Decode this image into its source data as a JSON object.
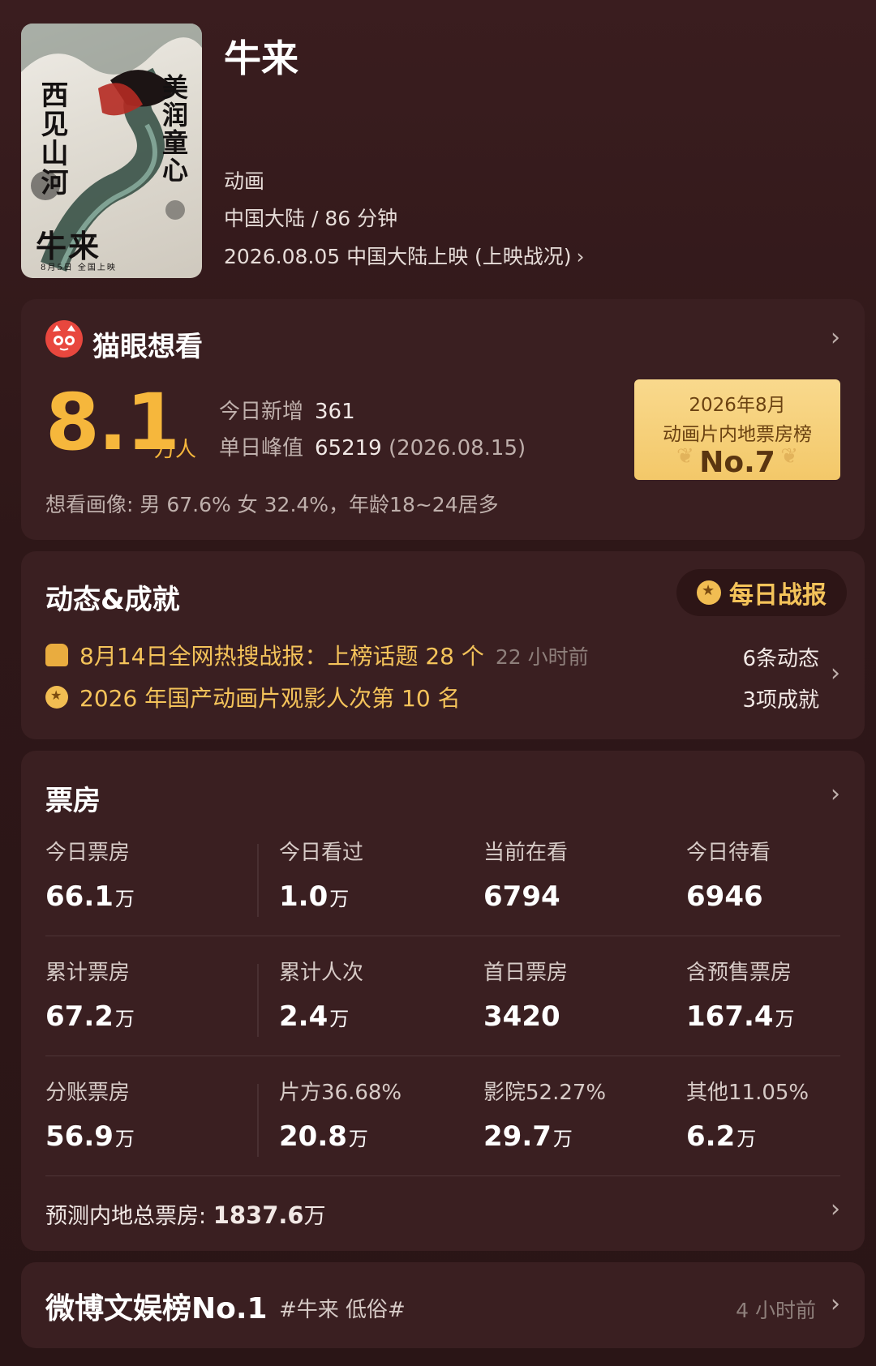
{
  "movie": {
    "poster_texts": [
      "西见山河",
      "美润童心",
      "牛来",
      "8月5日 全国上映"
    ],
    "title": "牛来",
    "genre": "动画",
    "region_runtime": "中国大陆 / 86 分钟",
    "release": "2026.08.05 中国大陆上映 (上映战况)"
  },
  "want": {
    "title": "猫眼想看",
    "number": "8.1",
    "unit": "万人",
    "today_label": "今日新增",
    "today_value": "361",
    "peak_label": "单日峰值",
    "peak_value": "65219",
    "peak_date": "(2026.08.15)",
    "portrait": "想看画像: 男 67.6%  女 32.4%，年龄18~24居多",
    "rank_line1": "2026年8月",
    "rank_line2": "动画片内地票房榜",
    "rank_line3": "No.7"
  },
  "dynamics": {
    "title": "动态&成就",
    "daily_button": "每日战报",
    "item1": "8月14日全网热搜战报：上榜话题 28 个",
    "item1_time": "22 小时前",
    "item2": "2026 年国产动画片观影人次第 10 名",
    "count1": "6条动态",
    "count2": "3项成就"
  },
  "boxoffice": {
    "title": "票房",
    "rows": [
      [
        {
          "label": "今日票房",
          "value": "66.1",
          "unit": "万"
        },
        {
          "label": "今日看过",
          "value": "1.0",
          "unit": "万"
        },
        {
          "label": "当前在看",
          "value": "6794",
          "unit": ""
        },
        {
          "label": "今日待看",
          "value": "6946",
          "unit": ""
        }
      ],
      [
        {
          "label": "累计票房",
          "value": "67.2",
          "unit": "万"
        },
        {
          "label": "累计人次",
          "value": "2.4",
          "unit": "万"
        },
        {
          "label": "首日票房",
          "value": "3420",
          "unit": ""
        },
        {
          "label": "含预售票房",
          "value": "167.4",
          "unit": "万"
        }
      ],
      [
        {
          "label": "分账票房",
          "value": "56.9",
          "unit": "万"
        },
        {
          "label": "片方36.68%",
          "value": "20.8",
          "unit": "万"
        },
        {
          "label": "影院52.27%",
          "value": "29.7",
          "unit": "万"
        },
        {
          "label": "其他11.05%",
          "value": "6.2",
          "unit": "万"
        }
      ]
    ],
    "forecast_label": "预测内地总票房: ",
    "forecast_value": "1837.6",
    "forecast_unit": "万"
  },
  "weibo": {
    "title": "微博文娱榜No.1",
    "tag": "#牛来 低俗#",
    "time": "4 小时前"
  },
  "colors": {
    "background": "#2e1718",
    "card": "#3a1f21",
    "accent_gold": "#f6b73c",
    "badge_gold": "#f3c869",
    "cat_red": "#e8473e"
  }
}
